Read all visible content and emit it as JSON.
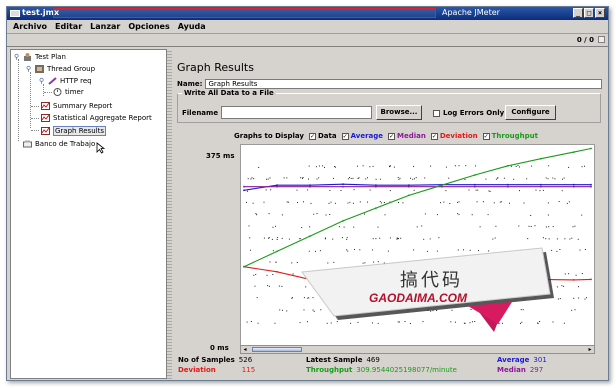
{
  "window": {
    "file": "test.jmx",
    "app_title": "Apache JMeter",
    "controls": [
      "_",
      "□",
      "×"
    ]
  },
  "menu": [
    "Archivo",
    "Editar",
    "Lanzar",
    "Opciones",
    "Ayuda"
  ],
  "toolbar": {
    "counter": "0 / 0"
  },
  "tree": {
    "test_plan": "Test Plan",
    "thread_group": "Thread Group",
    "http_req": "HTTP req",
    "timer": "timer",
    "summary_report": "Summary Report",
    "stat_report": "Statistical Aggregate Report",
    "graph_results": "Graph Results",
    "workbench": "Banco de Trabajo"
  },
  "panel": {
    "title": "Graph Results",
    "name_label": "Name:",
    "name_value": "Graph Results",
    "write_group": "Write All Data to a File",
    "filename_label": "Filename",
    "filename_value": "",
    "browse_button": "Browse...",
    "log_errors": "Log Errors Only",
    "configure_button": "Configure",
    "graphs_to_display": "Graphs to Display",
    "options": [
      {
        "label": "Data",
        "color": "#000000"
      },
      {
        "label": "Average",
        "color": "#1a1ad6"
      },
      {
        "label": "Median",
        "color": "#8a1a9a"
      },
      {
        "label": "Deviation",
        "color": "#e01b1b"
      },
      {
        "label": "Throughput",
        "color": "#1a9a1a"
      }
    ]
  },
  "chart_data": {
    "type": "line",
    "y_top_label": "375 ms",
    "y_bottom_label": "0 ms",
    "ylim": [
      0,
      375
    ],
    "x": [
      0,
      50,
      100,
      150,
      200,
      250,
      300,
      350,
      400,
      450,
      500,
      526
    ],
    "series": [
      {
        "name": "Average",
        "color": "#1a1ad6",
        "values": [
          290,
          300,
          300,
          302,
          300,
          300,
          301,
          301,
          301,
          301,
          301,
          301
        ]
      },
      {
        "name": "Median",
        "color": "#8a1a9a",
        "values": [
          297,
          297,
          297,
          297,
          297,
          297,
          297,
          297,
          297,
          297,
          297,
          297
        ]
      },
      {
        "name": "Deviation",
        "color": "#e01b1b",
        "values": [
          140,
          130,
          115,
          105,
          110,
          115,
          112,
          115,
          113,
          115,
          114,
          115
        ]
      },
      {
        "name": "Throughput",
        "color": "#1a9a1a",
        "values": [
          140,
          170,
          200,
          230,
          255,
          280,
          300,
          320,
          338,
          352,
          365,
          372
        ]
      }
    ]
  },
  "stats": {
    "samples_label": "No of Samples",
    "samples_value": "526",
    "latest_label": "Latest Sample",
    "latest_value": "469",
    "average_label": "Average",
    "average_value": "301",
    "deviation_label": "Deviation",
    "deviation_value": "115",
    "throughput_label": "Throughput",
    "throughput_value": "309.9544025198077/minute",
    "median_label": "Median",
    "median_value": "297"
  },
  "watermark": {
    "zh": "搞代码",
    "en": "GAODAIMA.COM"
  }
}
